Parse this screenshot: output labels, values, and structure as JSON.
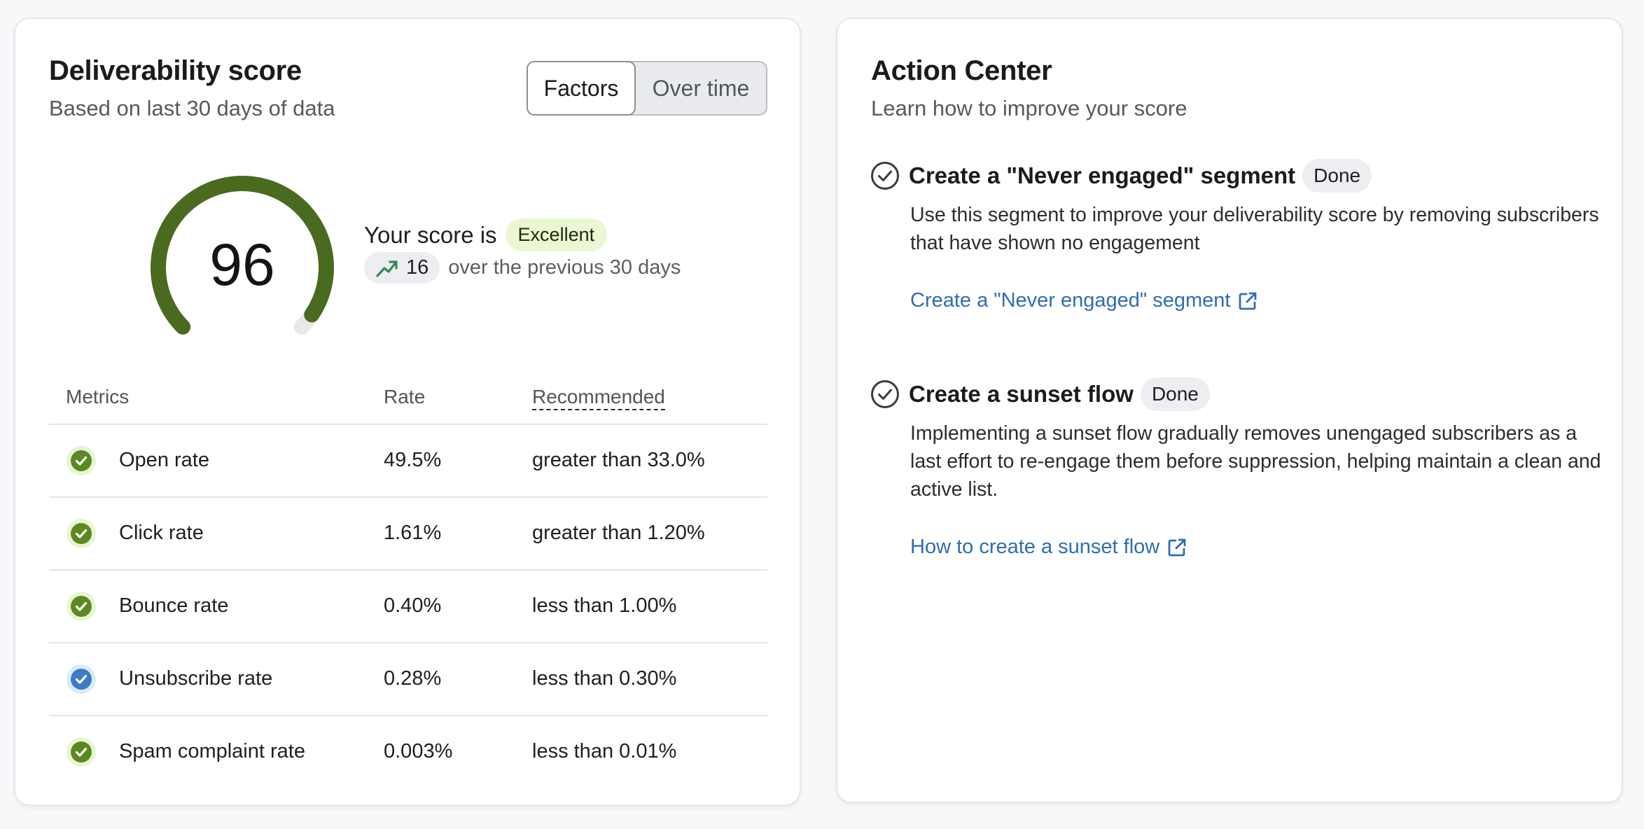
{
  "deliverability": {
    "title": "Deliverability score",
    "subtitle": "Based on last 30 days of data",
    "toggle": {
      "options": [
        "Factors",
        "Over time"
      ],
      "selected": "Factors"
    },
    "score": {
      "value": "96",
      "fraction": 0.96,
      "your_score_label": "Your score is",
      "rating": "Excellent",
      "change": "16",
      "change_text": "over the previous 30 days"
    },
    "table": {
      "headers": [
        "Metrics",
        "Rate",
        "Recommended"
      ],
      "rows": [
        {
          "metric": "Open rate",
          "rate": "49.5%",
          "recommended": "greater than 33.0%",
          "status": "success"
        },
        {
          "metric": "Click rate",
          "rate": "1.61%",
          "recommended": "greater than 1.20%",
          "status": "success"
        },
        {
          "metric": "Bounce rate",
          "rate": "0.40%",
          "recommended": "less than 1.00%",
          "status": "success"
        },
        {
          "metric": "Unsubscribe rate",
          "rate": "0.28%",
          "recommended": "less than 0.30%",
          "status": "info"
        },
        {
          "metric": "Spam complaint rate",
          "rate": "0.003%",
          "recommended": "less than 0.01%",
          "status": "success"
        }
      ]
    }
  },
  "action_center": {
    "title": "Action Center",
    "subtitle": "Learn how to improve your score",
    "items": [
      {
        "title": "Create a \"Never engaged\" segment",
        "badge": "Done",
        "description": "Use this segment to improve your deliverability score by removing subscribers that have shown no engagement",
        "link": "Create a \"Never engaged\" segment"
      },
      {
        "title": "Create a sunset flow",
        "badge": "Done",
        "description": "Implementing a sunset flow gradually removes unengaged subscribers as a last effort to re-engage them before suppression, helping maintain a clean and active list.",
        "link": "How to create a sunset flow"
      }
    ]
  },
  "colors": {
    "gauge_fill": "#4a6b1f",
    "gauge_track": "#e6e8eb",
    "success": "#5a8a1f",
    "success_halo": "#e8f5d3",
    "info": "#3e7bc6",
    "info_halo": "#dcebf8",
    "link": "#2f6db3",
    "trend_icon": "#2e8b57"
  },
  "icons": {
    "status_check": "check-circle-icon",
    "trend": "trending-up-icon",
    "action_check": "check-circle-outline-icon",
    "external_link": "external-link-icon"
  }
}
